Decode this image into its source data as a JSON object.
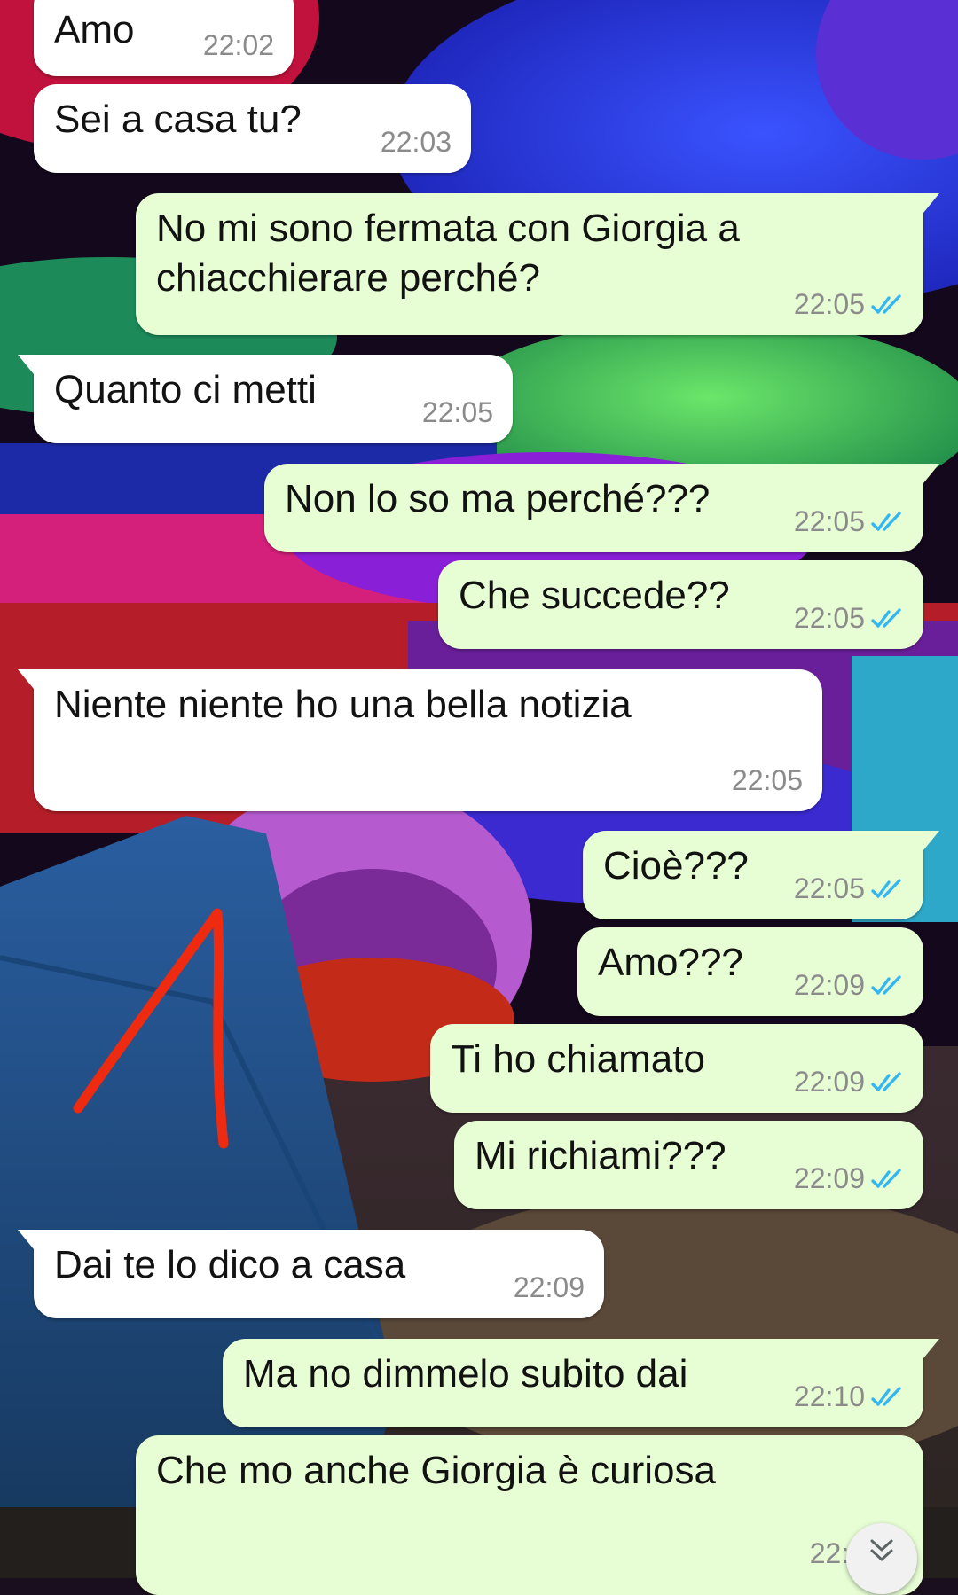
{
  "colors": {
    "incoming_bubble": "#ffffff",
    "outgoing_bubble": "#e7fed5",
    "timestamp": "#8b8b8b",
    "read_ticks": "#34b7f1",
    "annotation_arrow": "#ee2a10"
  },
  "icons": {
    "read_receipt": "double-check-icon",
    "scroll_down": "double-chevron-down-icon"
  },
  "messages": [
    {
      "direction": "in",
      "text": "Amo",
      "time": "22:02"
    },
    {
      "direction": "in",
      "text": "Sei a casa tu?",
      "time": "22:03"
    },
    {
      "direction": "out",
      "line1": "No mi sono fermata con Giorgia a",
      "line2": "chiacchierare perché?",
      "time": "22:05",
      "status": "read"
    },
    {
      "direction": "in",
      "text": "Quanto ci metti",
      "time": "22:05"
    },
    {
      "direction": "out",
      "text": "Non lo so ma perché???",
      "time": "22:05",
      "status": "read"
    },
    {
      "direction": "out",
      "text": "Che succede??",
      "time": "22:05",
      "status": "read"
    },
    {
      "direction": "in",
      "text": "Niente niente ho una bella notizia",
      "time": "22:05"
    },
    {
      "direction": "out",
      "text": "Cioè???",
      "time": "22:05",
      "status": "read"
    },
    {
      "direction": "out",
      "text": "Amo???",
      "time": "22:09",
      "status": "read"
    },
    {
      "direction": "out",
      "text": "Ti ho chiamato",
      "time": "22:09",
      "status": "read"
    },
    {
      "direction": "out",
      "text": "Mi richiami???",
      "time": "22:09",
      "status": "read"
    },
    {
      "direction": "in",
      "text": "Dai te lo dico a casa",
      "time": "22:09"
    },
    {
      "direction": "out",
      "text": "Ma no dimmelo subito dai",
      "time": "22:10",
      "status": "read"
    },
    {
      "direction": "out",
      "text": "Che mo anche Giorgia è curiosa",
      "time": "22:1",
      "status": "read"
    }
  ]
}
